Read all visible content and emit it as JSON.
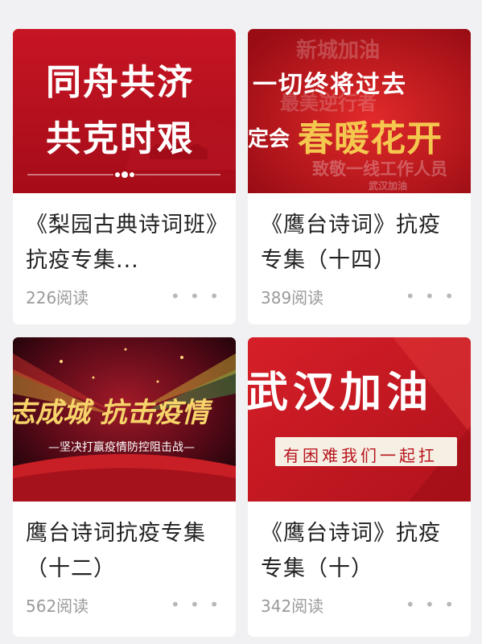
{
  "articles": [
    {
      "thumb_text": [
        "同舟共济",
        "共克时艰"
      ],
      "title": "《梨园古典诗词班》抗疫专集...",
      "reads": "226阅读",
      "more": "• • •"
    },
    {
      "thumb_text": [
        "一切终将过去",
        "春暖花开",
        "新城加油",
        "最美逆行者",
        "致敬一线工作人员",
        "定会",
        "武汉加油"
      ],
      "title": "《鹰台诗词》抗疫专集（十四）",
      "reads": "389阅读",
      "more": "• • •"
    },
    {
      "thumb_text": [
        "志成城 抗击疫情",
        "—坚决打赢疫情防控阻击战—"
      ],
      "title": "鹰台诗词抗疫专集（十二）",
      "reads": "562阅读",
      "more": "• • •"
    },
    {
      "thumb_text": [
        "武汉加油",
        "有困难我们一起扛"
      ],
      "title": "《鹰台诗词》抗疫专集（十）",
      "reads": "342阅读",
      "more": "• • •"
    }
  ],
  "colors": {
    "background": "#f1f1f3",
    "thumb_red": "#b8101e",
    "gold": "#f4c74f",
    "reads_gray": "#9a9a9a"
  }
}
